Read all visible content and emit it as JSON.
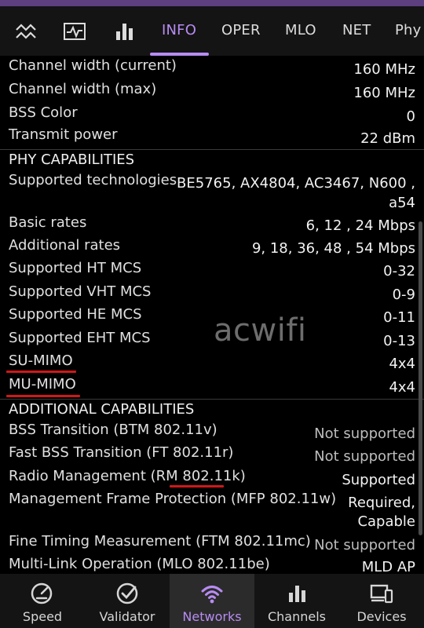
{
  "tabs": {
    "icons": [
      "stats-icon",
      "activity-icon",
      "bar-chart-icon"
    ],
    "labels": [
      "INFO",
      "OPER",
      "MLO",
      "NET",
      "Phy"
    ],
    "active": "INFO"
  },
  "info_rows": [
    {
      "label": "Channel width (current)",
      "value": "160 MHz"
    },
    {
      "label": "Channel width (max)",
      "value": "160 MHz"
    },
    {
      "label": "BSS Color",
      "value": "0"
    },
    {
      "label": "Transmit power",
      "value": "22 dBm"
    }
  ],
  "phy_capabilities": {
    "title": "PHY CAPABILITIES",
    "rows": [
      {
        "label": "Supported technologies",
        "value_line1": "BE5765, AX4804, AC3467, N600 ,",
        "value_line2": "a54"
      },
      {
        "label": "Basic rates",
        "value": "6, 12 , 24 Mbps"
      },
      {
        "label": "Additional rates",
        "value": "9, 18, 36, 48 , 54 Mbps"
      },
      {
        "label": "Supported HT MCS",
        "value": "0-32"
      },
      {
        "label": "Supported VHT MCS",
        "value": "0-9"
      },
      {
        "label": "Supported HE MCS",
        "value": "0-11"
      },
      {
        "label": "Supported EHT MCS",
        "value": "0-13"
      },
      {
        "label": "SU-MIMO",
        "value": "4x4"
      },
      {
        "label": "MU-MIMO",
        "value": "4x4"
      }
    ]
  },
  "additional_capabilities": {
    "title": "ADDITIONAL CAPABILITIES",
    "rows": [
      {
        "label": "BSS Transition (BTM 802.11v)",
        "value": "Not supported"
      },
      {
        "label": "Fast BSS Transition (FT 802.11r)",
        "value": "Not supported"
      },
      {
        "label": "Radio Management (RM 802.11k)",
        "value": "Supported"
      },
      {
        "label": "Management Frame Protection (MFP 802.11w)",
        "value_line1": "Required,",
        "value_line2": "Capable"
      },
      {
        "label": "Fine Timing Measurement (FTM 802.11mc)",
        "value": "Not supported"
      },
      {
        "label": "Multi-Link Operation (MLO 802.11be)",
        "value": "MLD AP"
      }
    ]
  },
  "watermark": "acwifi",
  "highlight_color": "#d01818",
  "accent_color": "#b78cf2",
  "bottom_nav": [
    {
      "label": "Speed",
      "icon": "speedometer-icon"
    },
    {
      "label": "Validator",
      "icon": "check-circle-icon"
    },
    {
      "label": "Networks",
      "icon": "wifi-icon",
      "active": true
    },
    {
      "label": "Channels",
      "icon": "bar-chart-icon"
    },
    {
      "label": "Devices",
      "icon": "devices-icon"
    }
  ]
}
